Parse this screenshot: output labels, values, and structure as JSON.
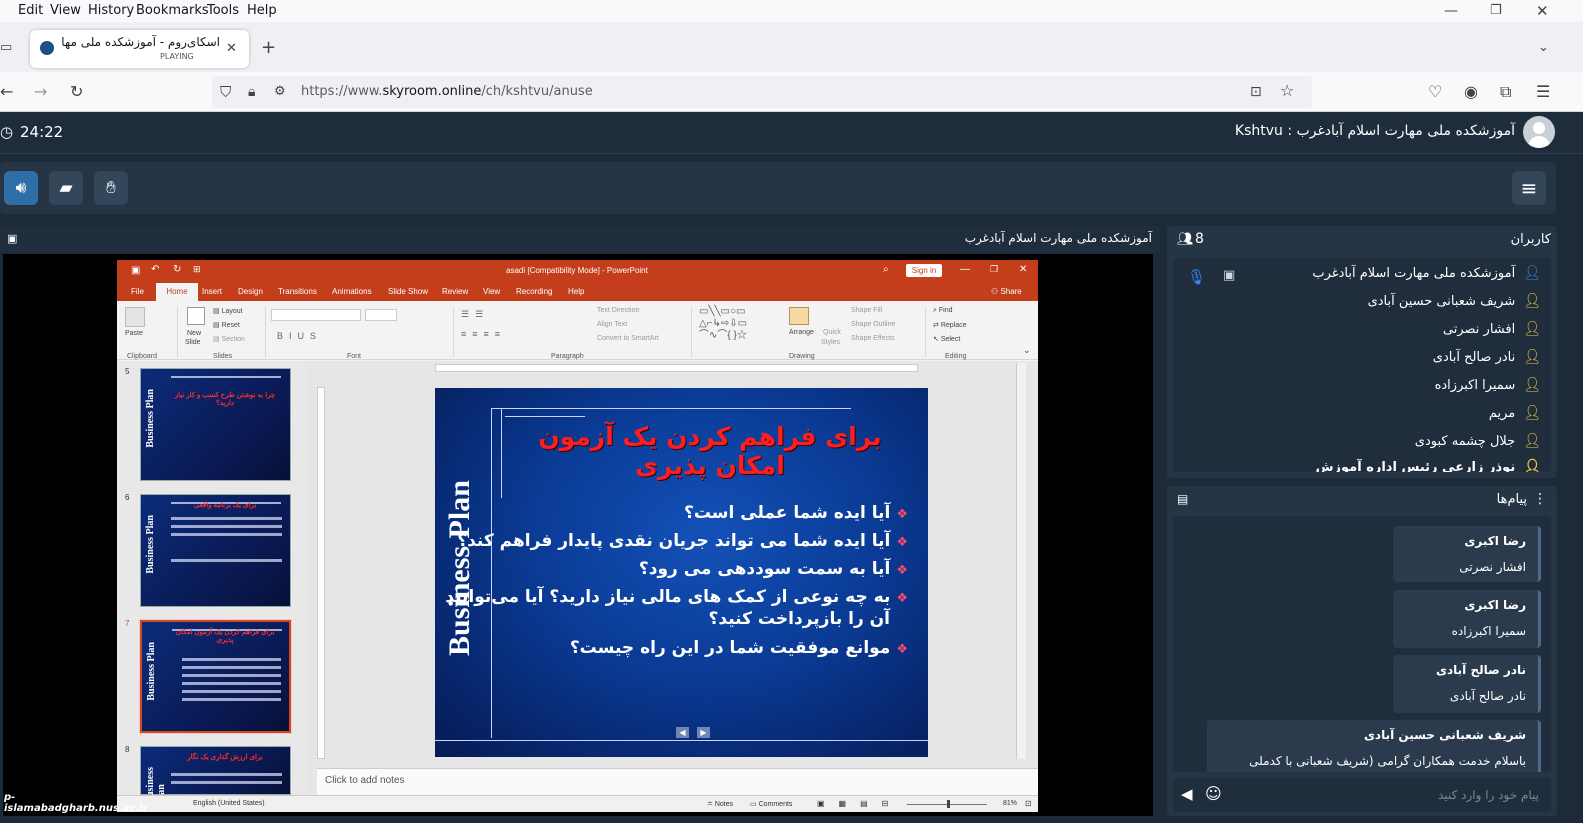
{
  "browser": {
    "menu": [
      "Edit",
      "View",
      "History",
      "Bookmarks",
      "Tools",
      "Help"
    ],
    "tab": {
      "title": "اسکای‌روم - آموزشکده ملی مهار",
      "status": "PLAYING"
    },
    "url_prefix": "https://www.",
    "url_host": "skyroom.online",
    "url_path": "/ch/kshtvu/anuse"
  },
  "app": {
    "timer": "24:22",
    "room_title": "Kshtvu : آموزشکده ملی مهارت اسلام آبادغرب",
    "stage_title": "آموزشکده ملی مهارت اسلام آبادغرب"
  },
  "ppt": {
    "window_title": "asadi [Compatibility Mode] - PowerPoint",
    "sign_in": "Sign in",
    "share": "Share",
    "tabs": [
      "File",
      "Home",
      "Insert",
      "Design",
      "Transitions",
      "Animations",
      "Slide Show",
      "Review",
      "View",
      "Recording",
      "Help"
    ],
    "groups": [
      "Clipboard",
      "Slides",
      "Font",
      "Paragraph",
      "Drawing",
      "Editing"
    ],
    "ribbon": {
      "paste": "Paste",
      "new_slide": "New",
      "new_slide2": "Slide",
      "layout": "Layout",
      "reset": "Reset",
      "section": "Section",
      "text_direction": "Text Direction",
      "align_text": "Align Text",
      "convert_smartart": "Convert to SmartArt",
      "arrange": "Arrange",
      "quick_styles": "Quick",
      "quick_styles2": "Styles",
      "shape_fill": "Shape Fill",
      "shape_outline": "Shape Outline",
      "shape_effects": "Shape Effects",
      "find": "Find",
      "replace": "Replace",
      "select": "Select"
    },
    "thumbnails": [
      {
        "num": "5",
        "title": "چرا به نوشتن طرح کسب و کار نیاز دارید؟"
      },
      {
        "num": "6",
        "title": "برای یک برنامه واقعی"
      },
      {
        "num": "7",
        "title": "برای فراهم کردن یک آزمون امکان پذیری"
      },
      {
        "num": "8",
        "title": "برای ارزش گذاری یک نگار"
      }
    ],
    "slide": {
      "vertical_text": "Business Plan",
      "title": "برای فراهم کردن یک آزمون امکان پذیری",
      "bullets": [
        "آیا ایده شما عملی است؟",
        "آیا ایده شما می تواند جریان نقدی پایدار فراهم کند؟",
        "آیا به سمت سوددهی می رود؟",
        "به چه نوعی از کمک های مالی نیاز دارید؟ آیا می‌توانید",
        "آن را بازپرداخت کنید؟",
        "موانع موفقیت شما در این راه چیست؟"
      ]
    },
    "notes_placeholder": "Click to add notes",
    "status": {
      "language": "English (United States)",
      "notes": "Notes",
      "comments": "Comments",
      "zoom": "81%"
    }
  },
  "users": {
    "title": "کاربران",
    "count": "8",
    "list": [
      "آموزشکده ملی مهارت اسلام آبادغرب",
      "شریف شعبانی حسین آبادی",
      "افشار نصرتی",
      "نادر صالح آبادی",
      "سمیرا اکبرزاده",
      "مریم",
      "جلال چشمه کبودی",
      "نوذر زارعی رئیس اداره آموزش"
    ]
  },
  "messages": {
    "title": "پیام‌ها",
    "items": [
      {
        "sender": "رضا اکبری",
        "text": "افشار نصرتی"
      },
      {
        "sender": "رضا اکبری",
        "text": "سمیرا اکبرزاده"
      },
      {
        "sender": "نادر صالح آبادی",
        "text": "نادر صالح آبادی"
      },
      {
        "sender": "شریف شعبانی حسین آبادی",
        "text": "باسلام خدمت همکاران گرامی (شریف شعبانی با کدملی"
      }
    ],
    "input_placeholder": "پیام خود را وارد کنید"
  },
  "watermark": "p-islamabadgharb.nus.ac.ir",
  "colors": {
    "accent": "#c43e1c",
    "panel": "#253546",
    "user_icon": "#f5d042",
    "mic": "#3d8bfd"
  }
}
